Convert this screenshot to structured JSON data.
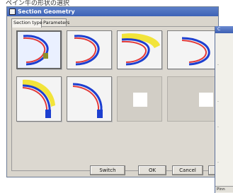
{
  "caption": "ペイン牛の形状の選択",
  "dialog": {
    "title": "Section Geometry",
    "tabs": [
      {
        "label": "Section type",
        "active": true
      },
      {
        "label": "Parameters",
        "active": false
      }
    ],
    "tiles": [
      {
        "kind": "c-blue-red-open-left"
      },
      {
        "kind": "c-blue-red"
      },
      {
        "kind": "c-blue-red-yellow"
      },
      {
        "kind": "c-blue-red-partial"
      },
      {
        "kind": "l-yellow-blue"
      },
      {
        "kind": "l-blue-red"
      },
      {
        "kind": "empty"
      },
      {
        "kind": "empty"
      }
    ],
    "buttons": {
      "switch": "Switch",
      "ok": "OK",
      "cancel": "Cancel"
    }
  },
  "side_window": {
    "title": "C",
    "footer": "Pinn"
  },
  "colors": {
    "titlebar": "#3d63b6",
    "dialog_bg": "#d9d5cc",
    "curve_blue": "#1d3fd0",
    "curve_red": "#e23a3a",
    "curve_yellow": "#f2e43a",
    "curve_olive": "#8a8f2a"
  }
}
